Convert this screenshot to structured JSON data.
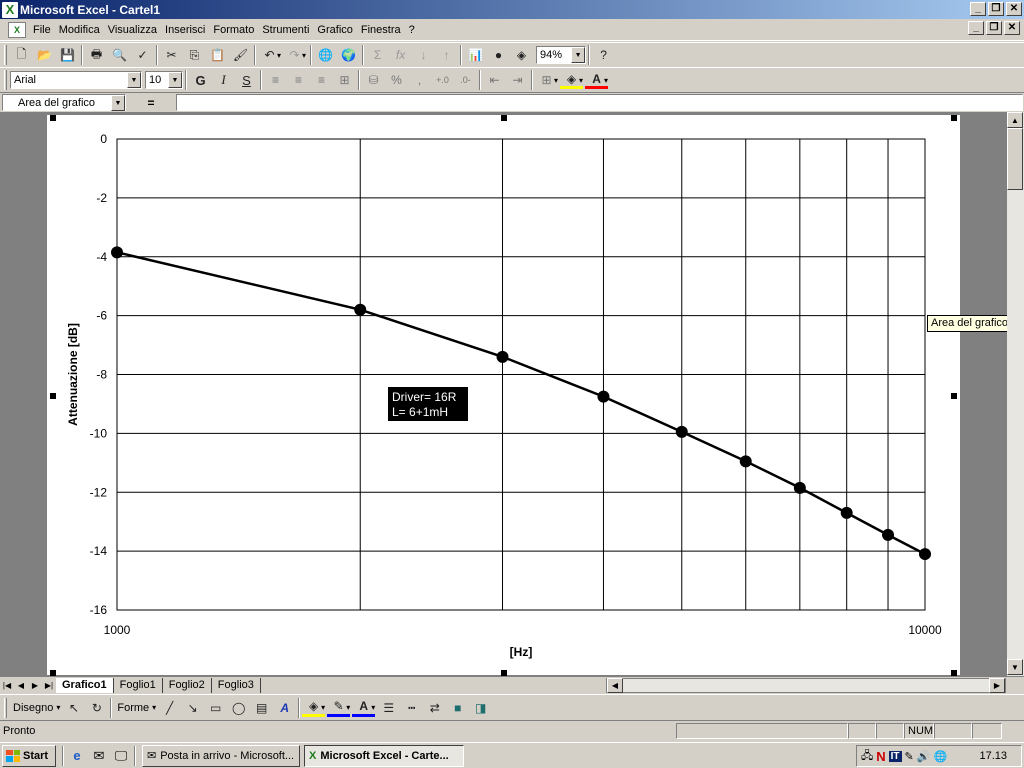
{
  "window": {
    "title": "Microsoft Excel - Cartel1"
  },
  "menu": [
    "File",
    "Modifica",
    "Visualizza",
    "Inserisci",
    "Formato",
    "Strumenti",
    "Grafico",
    "Finestra",
    "?"
  ],
  "toolbar": {
    "zoom": "94%",
    "font": "Arial",
    "size": "10",
    "bold": "G",
    "italic": "I",
    "underline": "S",
    "percent": "%"
  },
  "formula_bar": {
    "name_box": "Area del grafico",
    "eq": "="
  },
  "tooltip": "Area del grafico",
  "sheets": {
    "tabs": [
      "Grafico1",
      "Foglio1",
      "Foglio2",
      "Foglio3"
    ],
    "active": "Grafico1"
  },
  "drawing": {
    "draw_label": "Disegno",
    "shapes_label": "Forme"
  },
  "status": {
    "text": "Pronto",
    "num": "NUM"
  },
  "taskbar": {
    "start": "Start",
    "items": [
      "Posta in arrivo - Microsoft...",
      "Microsoft Excel - Carte..."
    ],
    "lang": "IT",
    "clock": "17.13"
  },
  "chart_data": {
    "type": "line",
    "title": "",
    "xlabel": "[Hz]",
    "ylabel": "Attenuazione [dB]",
    "x_scale": "log",
    "xlim": [
      1000,
      10000
    ],
    "ylim": [
      -16,
      0
    ],
    "y_ticks": [
      0,
      -2,
      -4,
      -6,
      -8,
      -10,
      -12,
      -14,
      -16
    ],
    "x_tick_labels": [
      "1000",
      "10000"
    ],
    "grid": true,
    "series": [
      {
        "x": [
          1000,
          2000,
          3000,
          4000,
          5000,
          6000,
          7000,
          8000,
          9000,
          10000
        ],
        "values": [
          -3.85,
          -5.8,
          -7.4,
          -8.75,
          -9.95,
          -10.95,
          -11.85,
          -12.7,
          -13.45,
          -14.1
        ]
      }
    ],
    "annotation": [
      "Driver= 16R",
      "L= 6+1mH"
    ]
  },
  "colors": {
    "title_bar": "#0a246a",
    "chart_bg": "#ffffff",
    "line": "#000000",
    "tooltip_bg": "#ffffe1"
  }
}
